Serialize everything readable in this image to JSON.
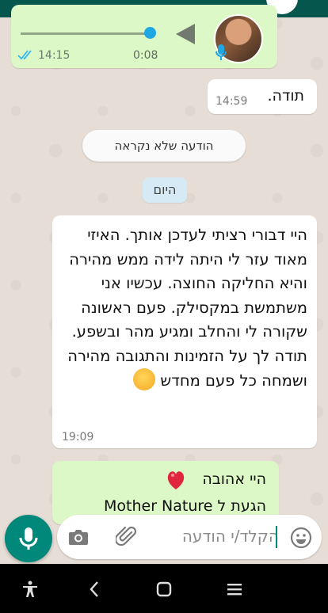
{
  "voice_note": {
    "time": "14:15",
    "duration": "0:08",
    "progress": 0.96
  },
  "messages": [
    {
      "text": "תודה.",
      "time": "14:59"
    }
  ],
  "unread_banner": "הודעה שלא נקראה",
  "date_divider": "היום",
  "long_message": {
    "text": "היי דבורי רציתי לעדכן אותך. האיזי מאוד עזר לי היתה לידה ממש מהירה והיא החליקה החוצה. עכשיו אני משתמשת במקסילק. פעם ראשונה שקורה לי והחלב ומגיע מהר ובשפע. תודה לך על הזמינות והתגובה מהירה ושמחה כל פעם מחדש",
    "time": "19:09"
  },
  "outgoing_partial": {
    "line1": "היי אהובה",
    "line2": "הגעת ל Mother Nature"
  },
  "input": {
    "placeholder": "הקלד/י הודעה"
  },
  "colors": {
    "header": "#05564c",
    "outgoing_bubble": "#dcf8c6",
    "accent": "#00897b",
    "knob": "#1fa7e4"
  },
  "icons": [
    "camera-icon",
    "attach-icon",
    "emoji-icon",
    "mic-icon",
    "accessibility-icon",
    "back-icon",
    "home-icon",
    "recents-icon",
    "heart-icon",
    "double-check-icon",
    "play-icon"
  ]
}
